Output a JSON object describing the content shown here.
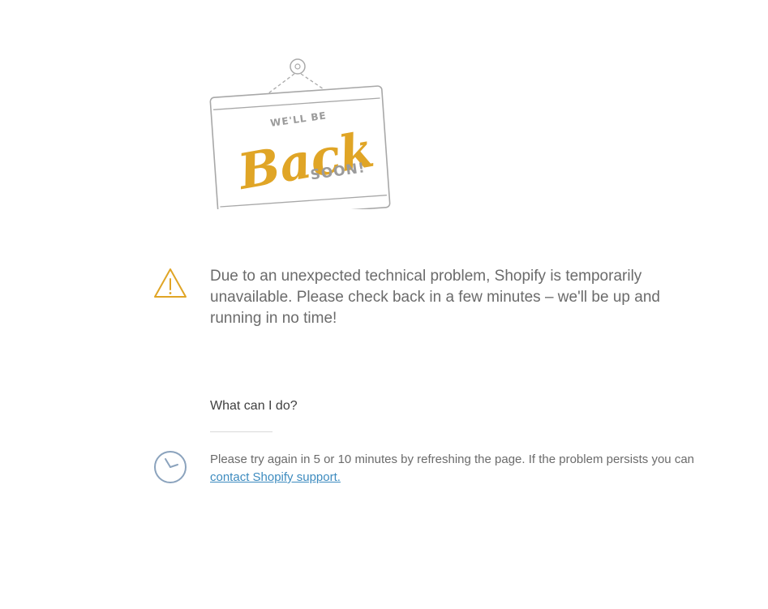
{
  "sign": {
    "top_text": "WE'LL BE",
    "main_text": "Back",
    "bottom_text": "SOON!"
  },
  "main": {
    "message": "Due to an unexpected technical problem, Shopify is temporarily unavailable. Please check back in a few minutes – we'll be up and running in no time!",
    "question": "What can I do?",
    "advice_text": "Please try again in 5 or 10 minutes by refreshing the page. If the problem persists you can",
    "support_link": "contact Shopify support."
  },
  "icons": {
    "warning": "warning-icon",
    "clock": "clock-icon"
  },
  "colors": {
    "accent_gold": "#e0a526",
    "link_blue": "#3d8bbf",
    "sign_gray": "#9b9b9b",
    "clock_blue": "#8ba3bd"
  }
}
